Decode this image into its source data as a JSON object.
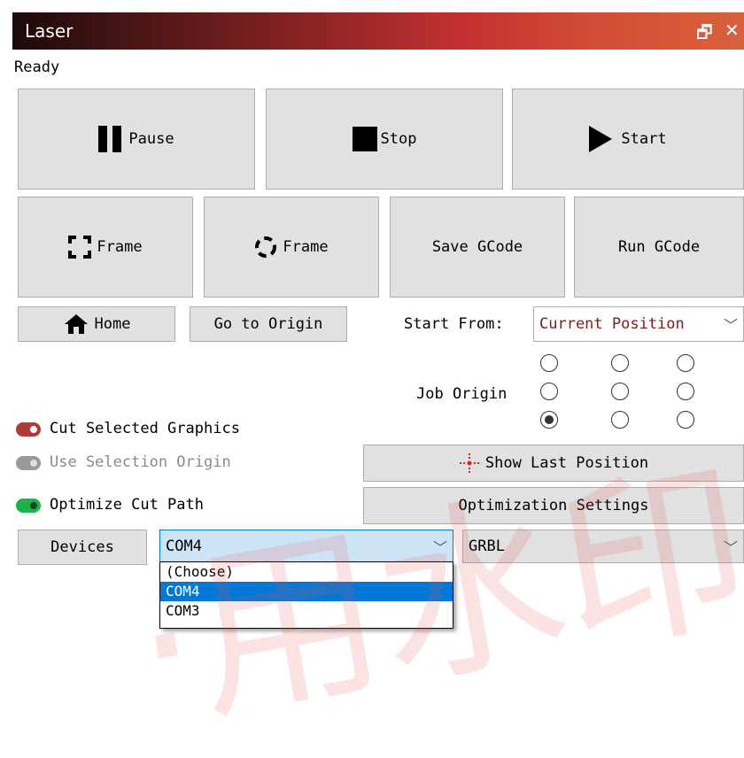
{
  "window": {
    "title": "Laser"
  },
  "status": "Ready",
  "controls": {
    "pause": "Pause",
    "stop": "Stop",
    "start": "Start",
    "frame_rect": "Frame",
    "frame_circle": "Frame",
    "save_gcode": "Save GCode",
    "run_gcode": "Run GCode",
    "home": "Home",
    "go_to_origin": "Go to Origin"
  },
  "start_from": {
    "label": "Start From:",
    "value": "Current Position"
  },
  "job_origin": {
    "label": "Job Origin",
    "selected_row": 3,
    "selected_col": 1
  },
  "options": {
    "cut_selected": "Cut Selected Graphics",
    "use_selection_origin": "Use Selection Origin",
    "optimize_cut_path": "Optimize Cut Path",
    "show_last_position": "Show Last Position",
    "optimization_settings": "Optimization Settings"
  },
  "devices": {
    "button": "Devices",
    "port": "COM4",
    "controller": "GRBL",
    "port_options": [
      "(Choose)",
      "COM4",
      "COM3"
    ],
    "selected_index": 1
  },
  "colors": {
    "toggle_on_red": "#b03a3a",
    "toggle_disabled": "#999999",
    "toggle_on_green": "#1db34a",
    "highlight": "#0078d7"
  }
}
